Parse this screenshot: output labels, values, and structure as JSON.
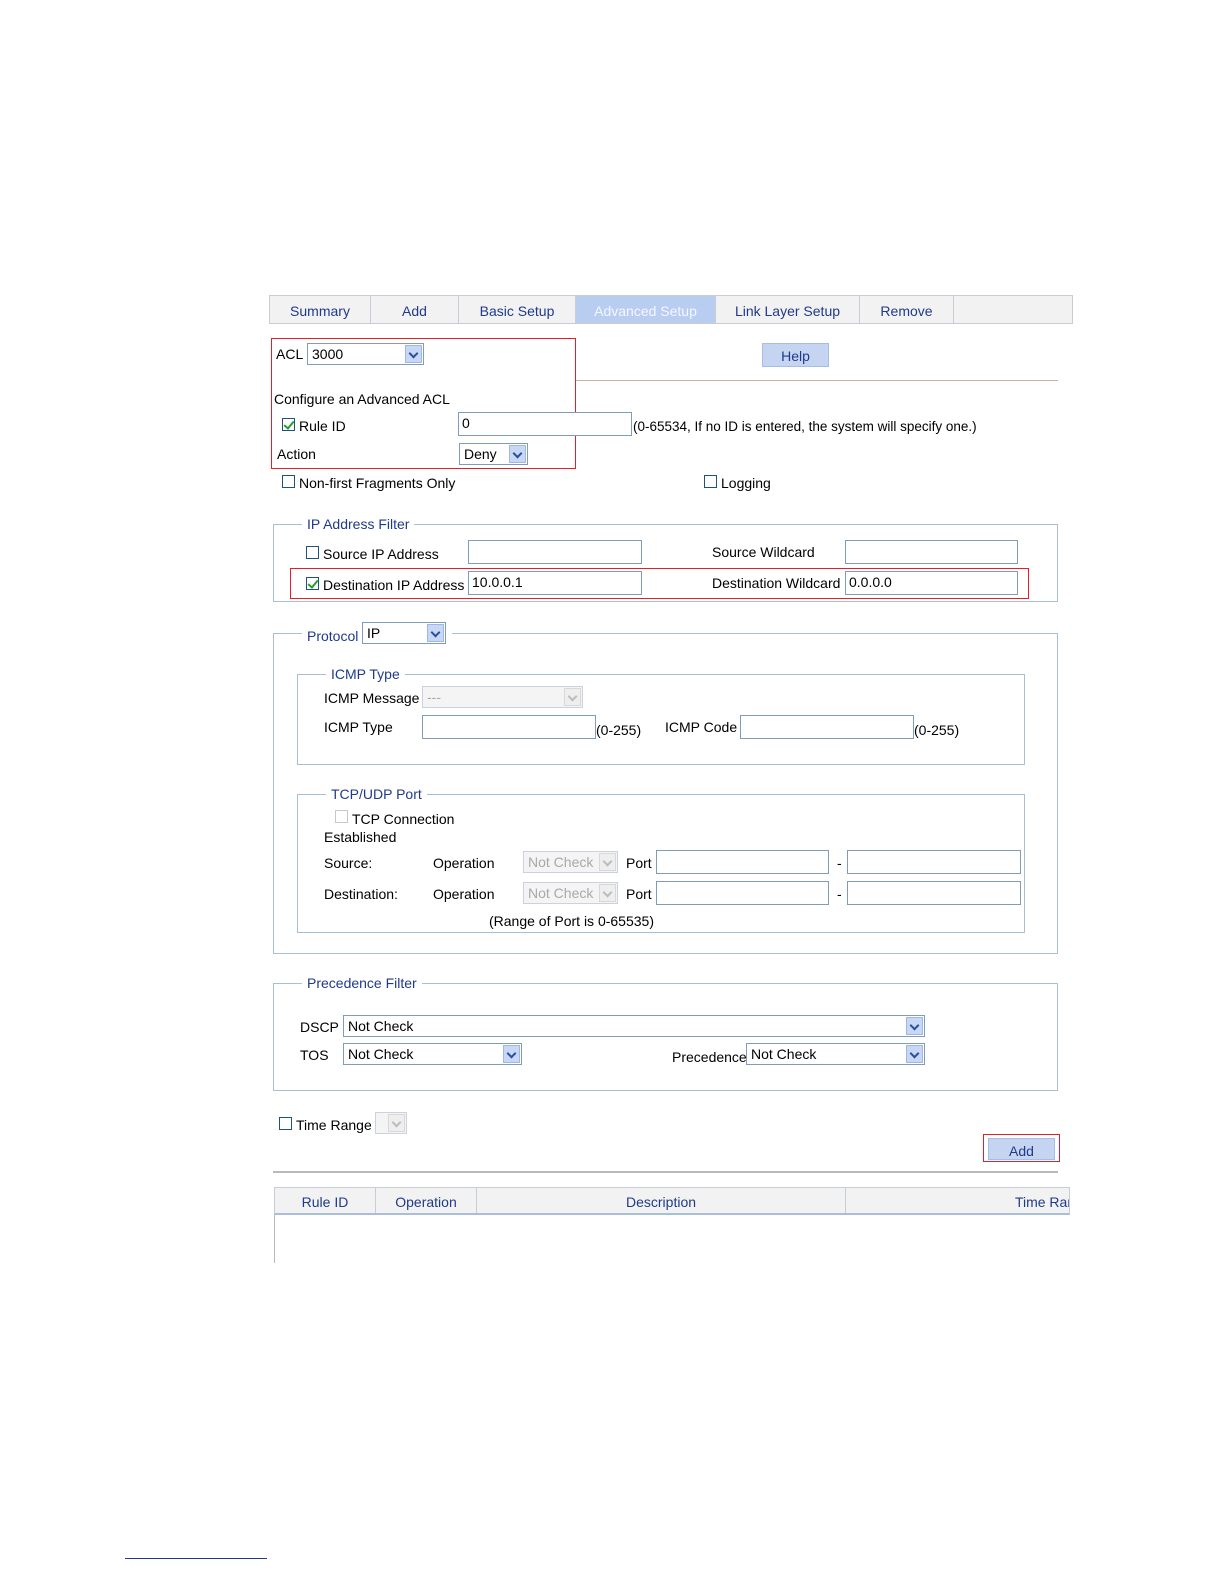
{
  "tabs": [
    "Summary",
    "Add",
    "Basic Setup",
    "Advanced Setup",
    "Link Layer Setup",
    "Remove"
  ],
  "active_tab": "Advanced Setup",
  "acl": {
    "label": "ACL",
    "value": "3000"
  },
  "help_label": "Help",
  "section_title": "Configure an Advanced ACL",
  "rule_id": {
    "label": "Rule ID",
    "checked": true,
    "value": "0",
    "hint": "(0-65534, If no ID is entered, the system will specify one.)"
  },
  "action": {
    "label": "Action",
    "value": "Deny"
  },
  "non_first_fragments": {
    "label": "Non-first Fragments Only",
    "checked": false
  },
  "logging": {
    "label": "Logging",
    "checked": false
  },
  "ip_filter": {
    "legend": "IP Address Filter",
    "source_ip_label": "Source IP Address",
    "source_ip_value": "",
    "source_wildcard_label": "Source Wildcard",
    "source_wildcard_value": "",
    "dest_ip_label": "Destination IP Address",
    "dest_ip_value": "10.0.0.1",
    "dest_wildcard_label": "Destination Wildcard",
    "dest_wildcard_value": "0.0.0.0"
  },
  "protocol": {
    "label": "Protocol",
    "value": "IP"
  },
  "icmp": {
    "legend": "ICMP Type",
    "message_label": "ICMP Message",
    "message_value": "---",
    "type_label": "ICMP Type",
    "type_range": "(0-255)",
    "code_label": "ICMP Code",
    "code_range": "(0-255)"
  },
  "tcpudp": {
    "legend": "TCP/UDP Port",
    "tcp_conn_line1": "TCP Connection",
    "tcp_conn_line2": "Established",
    "source_label": "Source:",
    "destination_label": "Destination:",
    "operation_label": "Operation",
    "operation_value": "Not Check",
    "port_label": "Port",
    "dash": "-",
    "range_note": "(Range of Port is 0-65535)"
  },
  "precedence_filter": {
    "legend": "Precedence Filter",
    "dscp_label": "DSCP",
    "dscp_value": "Not Check",
    "tos_label": "TOS",
    "tos_value": "Not Check",
    "precedence_label": "Precedence",
    "precedence_value": "Not Check"
  },
  "time_range_label": "Time Range",
  "add_label": "Add",
  "table_headers": [
    "Rule ID",
    "Operation",
    "Description",
    "Time Rar"
  ],
  "colors": {
    "accent_text": "#1f3a8a",
    "highlight_box": "#e0202a",
    "active_tab": "#b9cdf0",
    "button": "#c5d5f1"
  }
}
